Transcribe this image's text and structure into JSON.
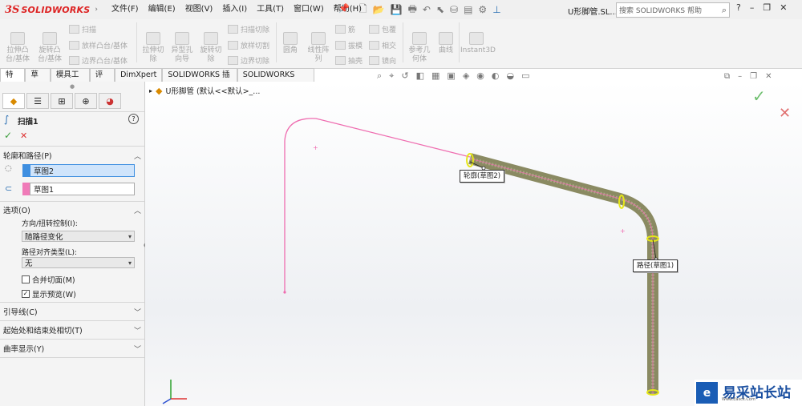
{
  "app": {
    "brand_prefix": "3S",
    "brand_name": "SOLIDWORKS"
  },
  "menus": [
    "文件(F)",
    "编辑(E)",
    "视图(V)",
    "插入(I)",
    "工具(T)",
    "窗口(W)",
    "帮助(H)"
  ],
  "document_title": "U形脚管.SL...",
  "search": {
    "placeholder": "搜索 SOLIDWORKS 帮助"
  },
  "ribbon": {
    "big": [
      {
        "l1": "拉伸凸",
        "l2": "台/基体"
      },
      {
        "l1": "旋转凸",
        "l2": "台/基体"
      },
      {
        "l1": "拉伸切",
        "l2": "除"
      },
      {
        "l1": "异型孔",
        "l2": "向导"
      },
      {
        "l1": "旋转切",
        "l2": "除"
      },
      {
        "l1": "圆角",
        "l2": ""
      },
      {
        "l1": "线性阵",
        "l2": "列"
      },
      {
        "l1": "参考几",
        "l2": "何体"
      },
      {
        "l1": "曲线",
        "l2": ""
      },
      {
        "l1": "Instant3D",
        "l2": ""
      }
    ],
    "small": [
      "扫描",
      "放样凸台/基体",
      "边界凸台/基体",
      "扫描切除",
      "放样切割",
      "边界切除",
      "筋",
      "拔模",
      "抽壳",
      "包覆",
      "相交",
      "镜向"
    ]
  },
  "command_tabs": [
    "特征",
    "草图",
    "模具工具",
    "评估",
    "DimXpert",
    "SOLIDWORKS 插件",
    "SOLIDWORKS MBD"
  ],
  "tree": {
    "label": "U形脚管 (默认<<默认>_..."
  },
  "panel": {
    "title": "扫描1",
    "profile_path": {
      "header": "轮廓和路径(P)",
      "profile_value": "草图2",
      "path_value": "草图1",
      "profile_color": "#3f8fe0",
      "path_color": "#f07ab8"
    },
    "options": {
      "header": "选项(O)",
      "orient_label": "方向/扭转控制(I):",
      "orient_value": "随路径变化",
      "align_label": "路径对齐类型(L):",
      "align_value": "无",
      "merge_label": "合并切面(M)",
      "merge_checked": false,
      "preview_label": "显示预览(W)",
      "preview_checked": true
    },
    "guides": "引导线(C)",
    "tangency": "起始处和结束处相切(T)",
    "curvature": "曲率显示(Y)"
  },
  "callouts": {
    "profile": "轮廓(草图2)",
    "path": "路径(草图1)"
  },
  "colors": {
    "path_line": "#ef6db0",
    "tube": "#8a8a62",
    "accept": "#3c9e3c",
    "cancel": "#e05050"
  },
  "watermark": {
    "text": "易采站长站",
    "sub": "Www.Easck.Com"
  }
}
